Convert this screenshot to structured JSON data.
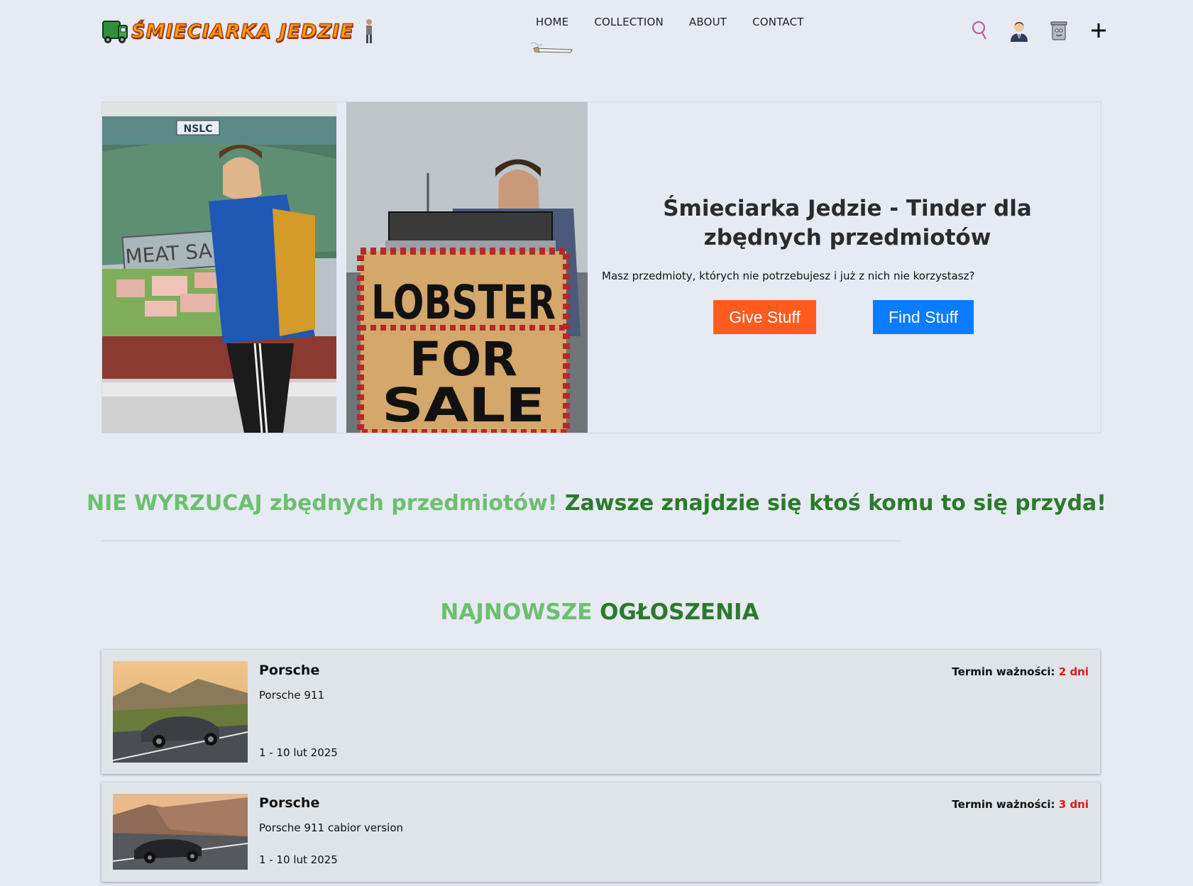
{
  "header": {
    "logo_text": "ŚMIECIARKA JEDZIE",
    "nav": [
      "HOME",
      "COLLECTION",
      "ABOUT",
      "CONTACT"
    ]
  },
  "hero": {
    "photo1_sign": "MEAT SALE",
    "photo1_store_sign": "NSLC",
    "photo2_sign": [
      "LOBSTER",
      "FOR",
      "SALE"
    ],
    "title": "Śmieciarka Jedzie - Tinder dla zbędnych przedmiotów",
    "subtitle": "Masz przedmioty, których nie potrzebujesz i już z nich nie korzystasz?",
    "give_button": "Give Stuff",
    "find_button": "Find Stuff"
  },
  "slogan": {
    "part1": "NIE WYRZUCAJ zbędnych przedmiotów!",
    "part2": "Zawsze znajdzie się ktoś komu to się przyda!"
  },
  "section": {
    "title_light": "NAJNOWSZE",
    "title_dark": "OGŁOSZENIA"
  },
  "listings": [
    {
      "title": "Porsche",
      "description": "Porsche 911",
      "date": "1 - 10 lut 2025",
      "expiry_label": "Termin ważności:",
      "expiry_value": "2 dni"
    },
    {
      "title": "Porsche",
      "description": "Porsche 911 cabior version",
      "date": "1 - 10 lut 2025",
      "expiry_label": "Termin ważności:",
      "expiry_value": "3 dni"
    }
  ],
  "colors": {
    "background": "#e6eaf3",
    "give": "#ff5b1f",
    "find": "#0a7cff",
    "green_light": "#6cbf6f",
    "green_dark": "#2b7a2b",
    "expiry": "#ee1111"
  }
}
